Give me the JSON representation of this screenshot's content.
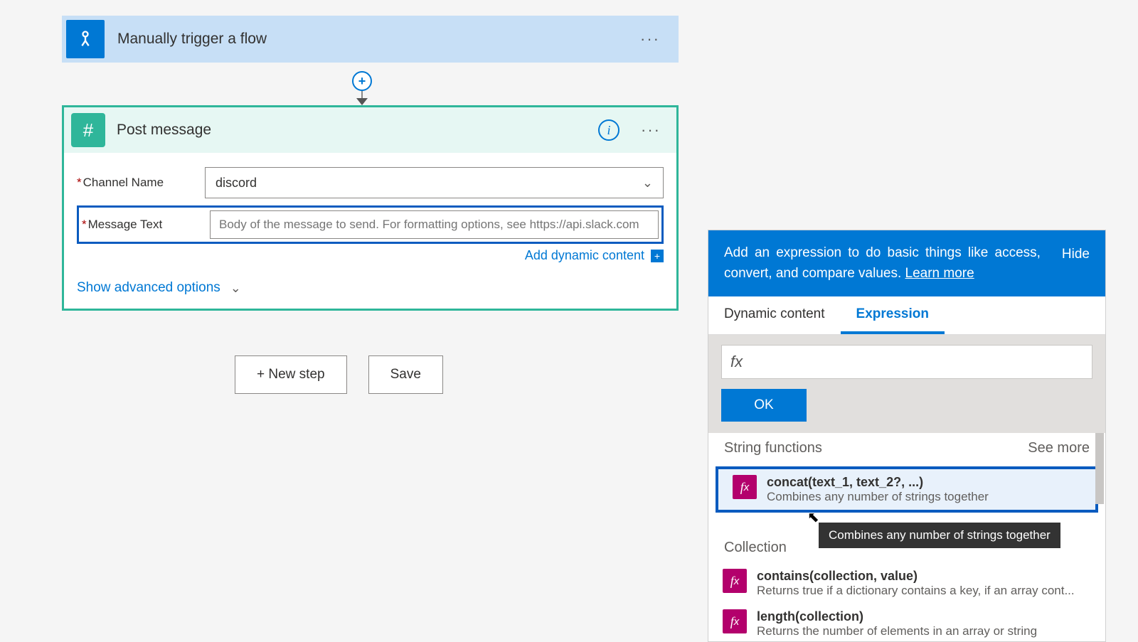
{
  "trigger": {
    "title": "Manually trigger a flow"
  },
  "action": {
    "title": "Post message",
    "fields": {
      "channel_label": "Channel Name",
      "channel_value": "discord",
      "message_label": "Message Text",
      "message_placeholder": "Body of the message to send. For formatting options, see https://api.slack.com"
    },
    "add_dynamic": "Add dynamic content",
    "show_advanced": "Show advanced options"
  },
  "buttons": {
    "new_step": "+ New step",
    "save": "Save"
  },
  "expr_panel": {
    "blurb": "Add an expression to do basic things like access, convert, and compare values.",
    "learn_more": "Learn more",
    "hide": "Hide",
    "tabs": {
      "dynamic": "Dynamic content",
      "expression": "Expression"
    },
    "fx_prefix": "fx",
    "ok": "OK",
    "sections": [
      {
        "title": "String functions",
        "see_more": "See more",
        "items": [
          {
            "name": "concat(text_1, text_2?, ...)",
            "desc": "Combines any number of strings together"
          }
        ]
      },
      {
        "title": "Collection",
        "see_more": "",
        "items": [
          {
            "name": "contains(collection, value)",
            "desc": "Returns true if a dictionary contains a key, if an array cont..."
          },
          {
            "name": "length(collection)",
            "desc": "Returns the number of elements in an array or string"
          }
        ]
      }
    ],
    "tooltip": "Combines any number of strings together"
  }
}
